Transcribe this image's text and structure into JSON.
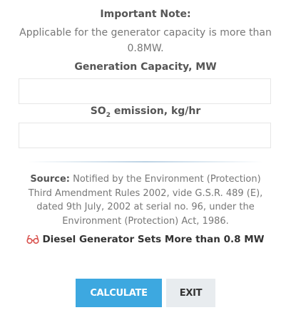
{
  "note": {
    "title": "Important Note:",
    "text": "Applicable for the generator capacity is more than 0.8MW."
  },
  "form": {
    "capacity_label": "Generation Capacity, MW",
    "capacity_value": "",
    "emission_label_prefix": "SO",
    "emission_label_sub": "2",
    "emission_label_suffix": " emission, kg/hr",
    "emission_value": ""
  },
  "source": {
    "label": "Source:",
    "text": " Notified by the Environment (Protection) Third Amendment Rules 2002, vide G.S.R. 489 (E), dated 9th July, 2002 at serial no. 96, under the Environment (Protection) Act, 1986."
  },
  "link": {
    "icon": "glasses-icon",
    "text": "Diesel Generator Sets More than 0.8 MW"
  },
  "buttons": {
    "calculate": "CALCULATE",
    "exit": "EXIT"
  },
  "colors": {
    "accent": "#3da8e0",
    "icon": "#d9534f"
  }
}
